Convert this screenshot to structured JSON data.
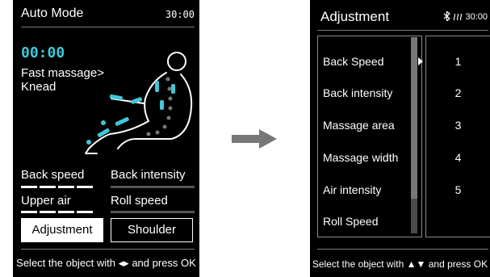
{
  "left_screen": {
    "title": "Auto Mode",
    "time": "30:00",
    "timer": "00:00",
    "program": "Fast massage> Knead",
    "options": {
      "back_speed": "Back speed",
      "back_intensity": "Back intensity",
      "upper_air": "Upper air",
      "roll_speed": "Roll speed"
    },
    "buttons": {
      "adjustment": "Adjustment",
      "shoulder": "Shoulder"
    },
    "footer_prefix": "Select the object with",
    "footer_arrows": "◂▸",
    "footer_suffix": "and press OK"
  },
  "right_screen": {
    "title": "Adjustment",
    "status_time": "30:00",
    "status_icons": [
      "bluetooth-icon",
      "heat-icon"
    ],
    "items": [
      "Back Speed",
      "Back intensity",
      "Massage area",
      "Massage width",
      "Air intensity",
      "Roll Speed"
    ],
    "values": [
      "1",
      "2",
      "3",
      "4",
      "5"
    ],
    "footer_prefix": "Select the object with",
    "footer_arrows": "▲▼",
    "footer_suffix": "and press OK"
  },
  "colors": {
    "screen_bg": "#000000",
    "text": "#ffffff",
    "accent": "#3fc8d8",
    "arrow": "#777777"
  }
}
